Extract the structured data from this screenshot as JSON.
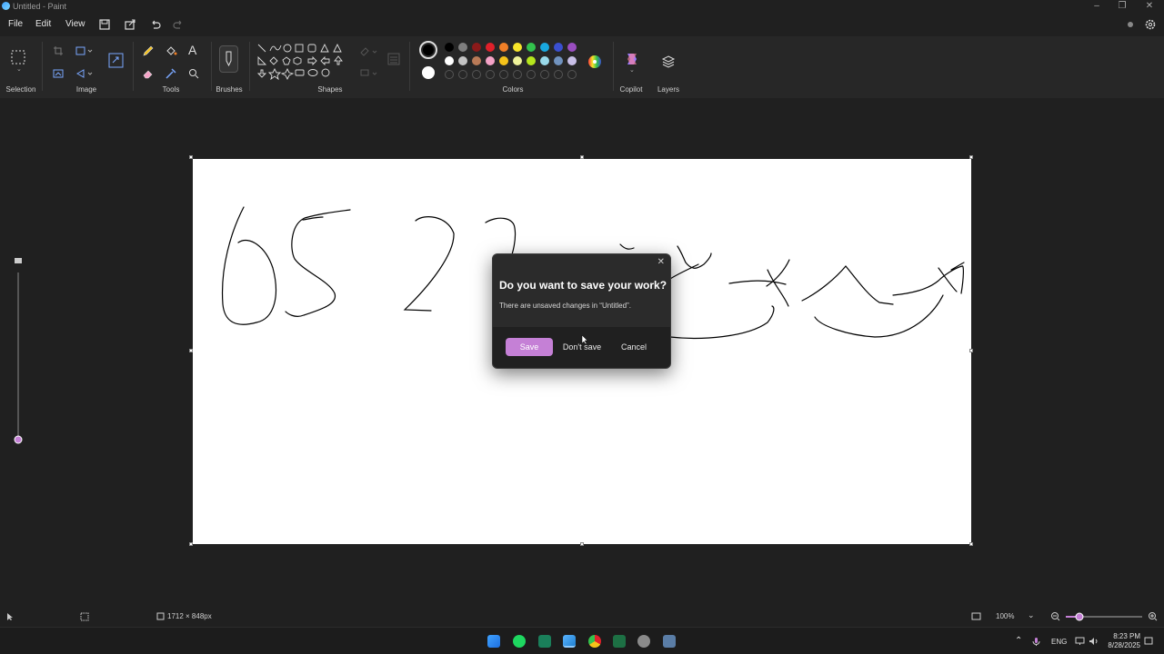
{
  "window": {
    "title": "Untitled - Paint"
  },
  "menu": {
    "file": "File",
    "edit": "Edit",
    "view": "View"
  },
  "ribbon": {
    "groups": {
      "selection": "Selection",
      "image": "Image",
      "tools": "Tools",
      "brushes": "Brushes",
      "shapes": "Shapes",
      "colors": "Colors",
      "copilot": "Copilot",
      "layers": "Layers"
    },
    "palette_row1": [
      "#000000",
      "#7f7f7f",
      "#8b1a1a",
      "#e0202a",
      "#f07f27",
      "#f7e52a",
      "#33c24d",
      "#19a8e0",
      "#3a4fd0",
      "#9a4ec0"
    ],
    "palette_row2": [
      "#ffffff",
      "#c3c3c3",
      "#b97a57",
      "#f5a3c7",
      "#f5c21a",
      "#eef29a",
      "#b5e61d",
      "#99d9ea",
      "#7092be",
      "#c8bfe7"
    ],
    "primary_color": "#000000",
    "secondary_color": "#ffffff"
  },
  "dialog": {
    "title": "Do you want to save your work?",
    "message": "There are unsaved changes in “Untitled”.",
    "save_label": "Save",
    "dont_save_label": "Don't save",
    "cancel_label": "Cancel",
    "accent": "#c580d6"
  },
  "status": {
    "canvas_size": "1712 × 848px",
    "zoom": "100%"
  },
  "taskbar": {
    "lang": "ENG",
    "time": "8:23 PM",
    "date": "8/28/2025"
  }
}
